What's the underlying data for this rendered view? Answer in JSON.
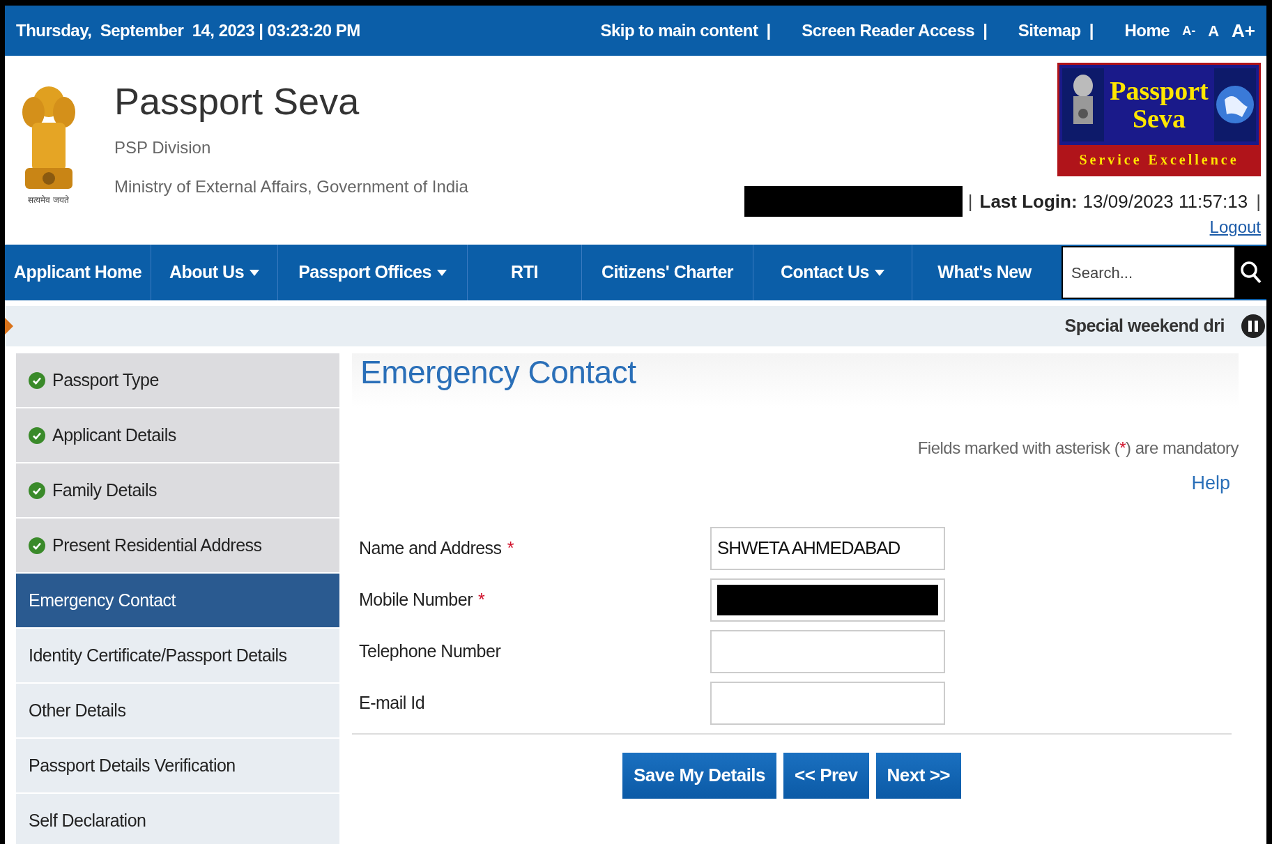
{
  "top_bar": {
    "datetime": "Thursday,  September  14, 2023 | 03:23:20 PM",
    "links": [
      {
        "label": "Skip to main content",
        "separator": "|"
      },
      {
        "label": "Screen Reader Access",
        "separator": "|"
      },
      {
        "label": "Sitemap",
        "separator": "|"
      },
      {
        "label": "Home"
      }
    ],
    "font_sizes": [
      "A-",
      "A",
      "A+"
    ]
  },
  "header": {
    "title": "Passport Seva",
    "subtitle": "PSP Division",
    "ministry": "Ministry of External Affairs, Government of India",
    "emblem_caption": "सत्यमेव जयते",
    "logo": {
      "line1": "Passport",
      "line2": "Seva",
      "tagline": "Service Excellence"
    },
    "last_login_label": "Last Login:",
    "last_login_value": "13/09/2023 11:57:13",
    "separator": "|",
    "logout": "Logout"
  },
  "nav": {
    "items": [
      {
        "label": "Applicant Home",
        "dropdown": false
      },
      {
        "label": "About Us",
        "dropdown": true
      },
      {
        "label": "Passport Offices",
        "dropdown": true
      },
      {
        "label": "RTI",
        "dropdown": false
      },
      {
        "label": "Citizens' Charter",
        "dropdown": false
      },
      {
        "label": "Contact Us",
        "dropdown": true
      },
      {
        "label": "What's New",
        "dropdown": false
      }
    ],
    "search_placeholder": "Search..."
  },
  "ticker": {
    "text": "Special weekend dri"
  },
  "sidebar": {
    "items": [
      {
        "label": "Passport Type",
        "done": true,
        "selected": false
      },
      {
        "label": "Applicant Details",
        "done": true,
        "selected": false
      },
      {
        "label": "Family Details",
        "done": true,
        "selected": false
      },
      {
        "label": "Present Residential Address",
        "done": true,
        "selected": false
      },
      {
        "label": "Emergency Contact",
        "done": false,
        "selected": true
      },
      {
        "label": "Identity Certificate/Passport Details",
        "done": false,
        "selected": false
      },
      {
        "label": "Other Details",
        "done": false,
        "selected": false
      },
      {
        "label": "Passport Details Verification",
        "done": false,
        "selected": false
      },
      {
        "label": "Self Declaration",
        "done": false,
        "selected": false
      }
    ]
  },
  "form": {
    "title": "Emergency Contact",
    "mandatory_note": {
      "before": "Fields marked with asterisk (",
      "mark": "*",
      "after": ") are mandatory"
    },
    "help": "Help",
    "required_mark": "*",
    "fields": [
      {
        "label": "Name and Address",
        "required": true,
        "value": "SHWETA AHMEDABAD",
        "redacted": false
      },
      {
        "label": "Mobile Number",
        "required": true,
        "redacted": true
      },
      {
        "label": "Telephone Number",
        "required": false,
        "redacted": false
      },
      {
        "label": "E-mail Id",
        "required": false,
        "redacted": false
      }
    ],
    "buttons": [
      "Save My Details",
      "<< Prev",
      "Next >>"
    ]
  }
}
